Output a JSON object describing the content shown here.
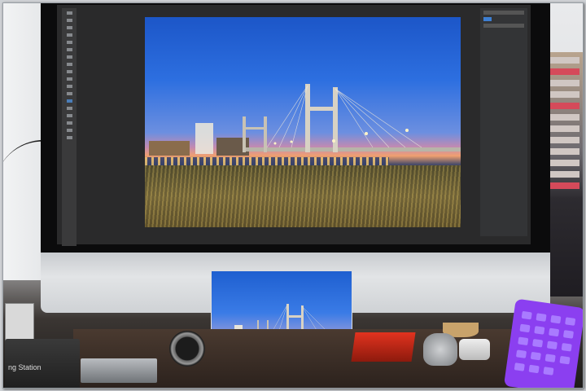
{
  "scene": {
    "dock_label": "ng Station",
    "hdd_label": "",
    "photo_colors": {
      "sky_top": "#1c56c8",
      "sky_horizon": "#f0a070",
      "grass": "#8c7a44"
    },
    "keypad_color": "#8b3ff0"
  },
  "icons": {
    "monitor": "imac-icon",
    "camera_watch": "watch-icon",
    "keypad": "numeric-keypad-icon"
  }
}
